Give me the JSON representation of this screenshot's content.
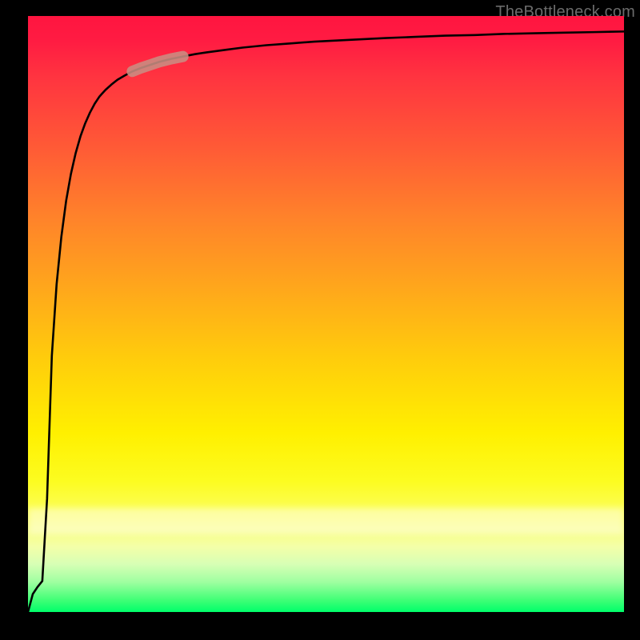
{
  "watermark": "TheBottleneck.com",
  "colors": {
    "curve": "#000000",
    "highlight": "#c98d82",
    "background_frame": "#000000"
  },
  "chart_data": {
    "type": "line",
    "title": "",
    "xlabel": "",
    "ylabel": "",
    "x": [
      0.0,
      0.008,
      0.016,
      0.024,
      0.032,
      0.04,
      0.048,
      0.056,
      0.064,
      0.072,
      0.08,
      0.088,
      0.096,
      0.104,
      0.112,
      0.12,
      0.13,
      0.14,
      0.15,
      0.162,
      0.175,
      0.19,
      0.205,
      0.22,
      0.24,
      0.26,
      0.28,
      0.3,
      0.33,
      0.36,
      0.4,
      0.44,
      0.48,
      0.52,
      0.56,
      0.6,
      0.65,
      0.7,
      0.75,
      0.8,
      0.85,
      0.9,
      0.95,
      1.0
    ],
    "values": [
      0.0,
      0.03,
      0.042,
      0.052,
      0.19,
      0.43,
      0.55,
      0.63,
      0.69,
      0.735,
      0.77,
      0.798,
      0.82,
      0.838,
      0.853,
      0.865,
      0.876,
      0.885,
      0.893,
      0.9,
      0.907,
      0.913,
      0.918,
      0.923,
      0.928,
      0.932,
      0.936,
      0.939,
      0.943,
      0.947,
      0.951,
      0.954,
      0.957,
      0.959,
      0.961,
      0.963,
      0.965,
      0.967,
      0.968,
      0.97,
      0.971,
      0.972,
      0.973,
      0.974
    ],
    "xlim": [
      0,
      1
    ],
    "ylim": [
      0,
      1
    ],
    "grid": false,
    "highlight_segment": {
      "x_start": 0.175,
      "x_end": 0.26
    }
  }
}
